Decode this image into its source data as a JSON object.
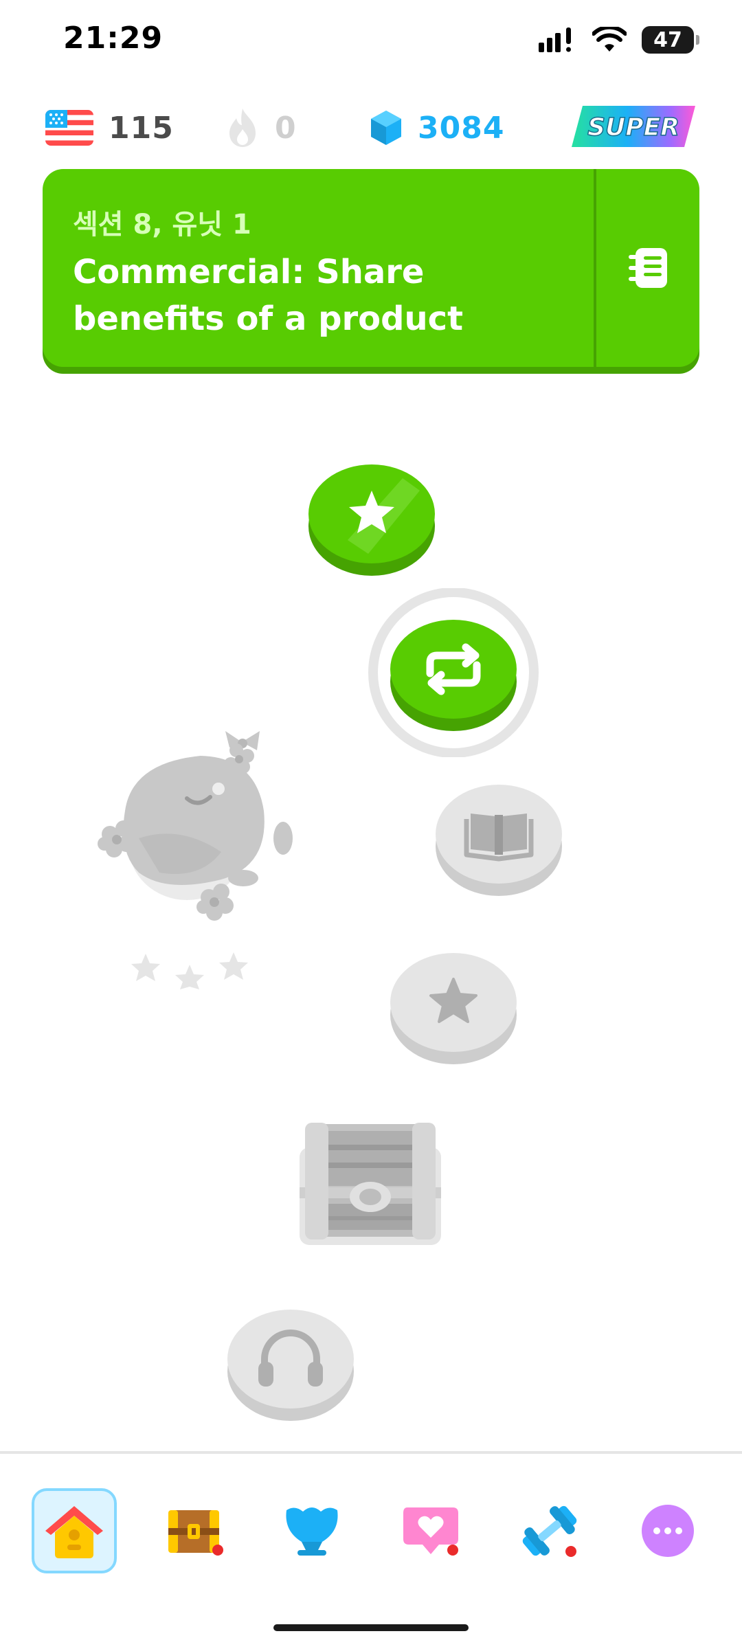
{
  "status_bar": {
    "time": "21:29",
    "battery": "47"
  },
  "stats": {
    "flag_icon": "us-flag-icon",
    "course_count": "115",
    "streak": "0",
    "gems": "3084",
    "super_label": "SUPER"
  },
  "unit_banner": {
    "section": "섹션 8, 유닛 1",
    "title": "Commercial: Share benefits of a product",
    "guide_icon": "notebook-icon"
  },
  "path": {
    "nodes": [
      {
        "icon": "star-icon",
        "state": "completed"
      },
      {
        "icon": "practice-icon",
        "state": "active"
      },
      {
        "icon": "book-icon",
        "state": "locked"
      },
      {
        "icon": "star-icon",
        "state": "locked"
      },
      {
        "icon": "treasure-chest-icon",
        "state": "locked"
      },
      {
        "icon": "headphones-icon",
        "state": "locked"
      }
    ]
  },
  "nav": {
    "items": [
      "home-icon",
      "chest-icon",
      "league-icon",
      "hearts-icon",
      "workout-icon",
      "more-icon"
    ],
    "colors": {
      "green": "#58cc02",
      "blue": "#1cb0f6",
      "locked": "#e5e5e5"
    }
  }
}
